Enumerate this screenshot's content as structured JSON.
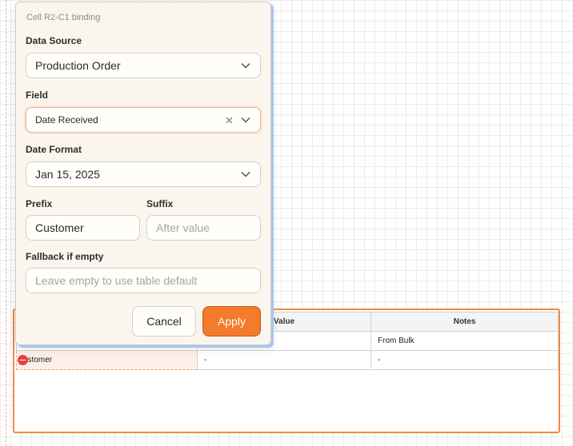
{
  "popover": {
    "title": "Cell R2-C1 binding",
    "data_source": {
      "label": "Data Source",
      "value": "Production Order"
    },
    "field": {
      "label": "Field",
      "value": "Date Received"
    },
    "date_format": {
      "label": "Date Format",
      "value": "Jan 15, 2025"
    },
    "prefix": {
      "label": "Prefix",
      "value": "Customer"
    },
    "suffix": {
      "label": "Suffix",
      "placeholder": "After value"
    },
    "fallback": {
      "label": "Fallback if empty",
      "placeholder": "Leave empty to use table default"
    },
    "cancel_label": "Cancel",
    "apply_label": "Apply"
  },
  "table": {
    "headers": [
      "",
      "Value",
      "Notes"
    ],
    "rows": [
      [
        "",
        "",
        "From Bulk"
      ],
      [
        "ustomer",
        "-",
        "-"
      ]
    ]
  },
  "colors": {
    "accent": "#f47a2c",
    "selection_border": "#f08a3c",
    "popover_bg": "#faf6ee",
    "focus_ring": "#f3b58c",
    "cell_flag": "#e8443a"
  },
  "icons": {
    "dropdown": "chevron-down-icon",
    "clear": "clear-x-icon",
    "cell_flag": "remove-binding-icon"
  }
}
